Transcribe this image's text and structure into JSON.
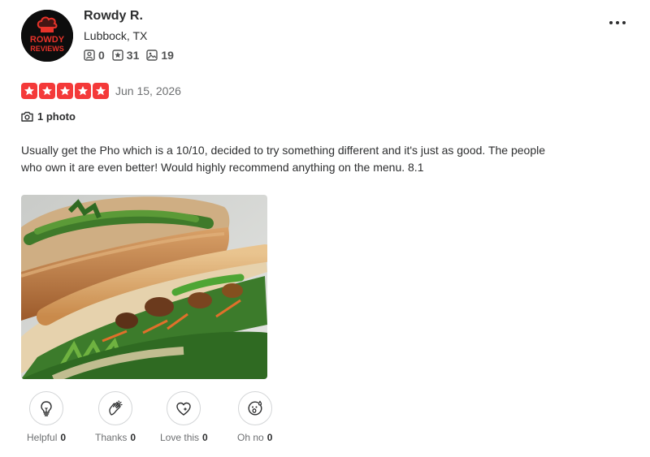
{
  "user": {
    "name": "Rowdy R.",
    "location": "Lubbock, TX",
    "avatar_text_top": "ROWDY",
    "avatar_text_bottom": "REVIEWS",
    "friends_count": "0",
    "reviews_count": "31",
    "photos_count": "19"
  },
  "review": {
    "rating": 5,
    "date": "Jun 15, 2026",
    "photo_count_label": "1 photo",
    "text": "Usually get the Pho which is a 10/10, decided to try something different and it's just as good. The people who own it are even better! Would highly recommend anything on the menu. 8.1"
  },
  "reactions": [
    {
      "label": "Helpful",
      "count": "0",
      "icon": "lightbulb-icon"
    },
    {
      "label": "Thanks",
      "count": "0",
      "icon": "clapping-hands-icon"
    },
    {
      "label": "Love this",
      "count": "0",
      "icon": "heart-sparkle-icon"
    },
    {
      "label": "Oh no",
      "count": "0",
      "icon": "surprised-face-icon"
    }
  ],
  "colors": {
    "star_red": "#f43939",
    "text": "#2d2e2f",
    "muted": "#6e7072",
    "avatar_red": "#e8332a"
  }
}
